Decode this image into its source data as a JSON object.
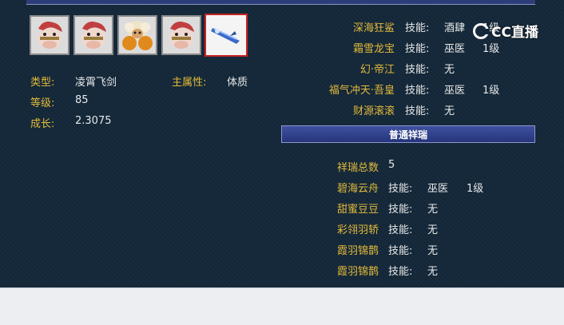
{
  "pets": [
    {
      "name": "horse-pet-1"
    },
    {
      "name": "horse-pet-2"
    },
    {
      "name": "sheep-pet"
    },
    {
      "name": "horse-pet-3"
    },
    {
      "name": "flying-sword-mount"
    }
  ],
  "info": {
    "type_label": "类型:",
    "type_value": "凌霄飞剑",
    "attr_label": "主属性:",
    "attr_value": "体质",
    "level_label": "等级:",
    "level_value": "85",
    "growth_label": "成长:",
    "growth_value": "2.3075"
  },
  "upper_list": [
    {
      "name": "深海狂鲨",
      "skill_label": "技能:",
      "skill": "酒肆",
      "level": "1级"
    },
    {
      "name": "霜雪龙宝",
      "skill_label": "技能:",
      "skill": "巫医",
      "level": "1级"
    },
    {
      "name": "幻·帝江",
      "skill_label": "技能:",
      "skill": "无",
      "level": ""
    },
    {
      "name": "福气冲天·吾皇",
      "skill_label": "技能:",
      "skill": "巫医",
      "level": "1级"
    },
    {
      "name": "财源滚滚",
      "skill_label": "技能:",
      "skill": "无",
      "level": ""
    }
  ],
  "section_title": "普通祥瑞",
  "total": {
    "label": "祥瑞总数",
    "value": "5"
  },
  "lower_list": [
    {
      "name": "碧海云舟",
      "skill_label": "技能:",
      "skill": "巫医",
      "level": "1级"
    },
    {
      "name": "甜蜜豆豆",
      "skill_label": "技能:",
      "skill": "无",
      "level": ""
    },
    {
      "name": "彩翎羽轿",
      "skill_label": "技能:",
      "skill": "无",
      "level": ""
    },
    {
      "name": "霞羽锦鹊",
      "skill_label": "技能:",
      "skill": "无",
      "level": ""
    },
    {
      "name": "霞羽锦鹊",
      "skill_label": "技能:",
      "skill": "无",
      "level": ""
    }
  ],
  "watermark": "CC直播"
}
